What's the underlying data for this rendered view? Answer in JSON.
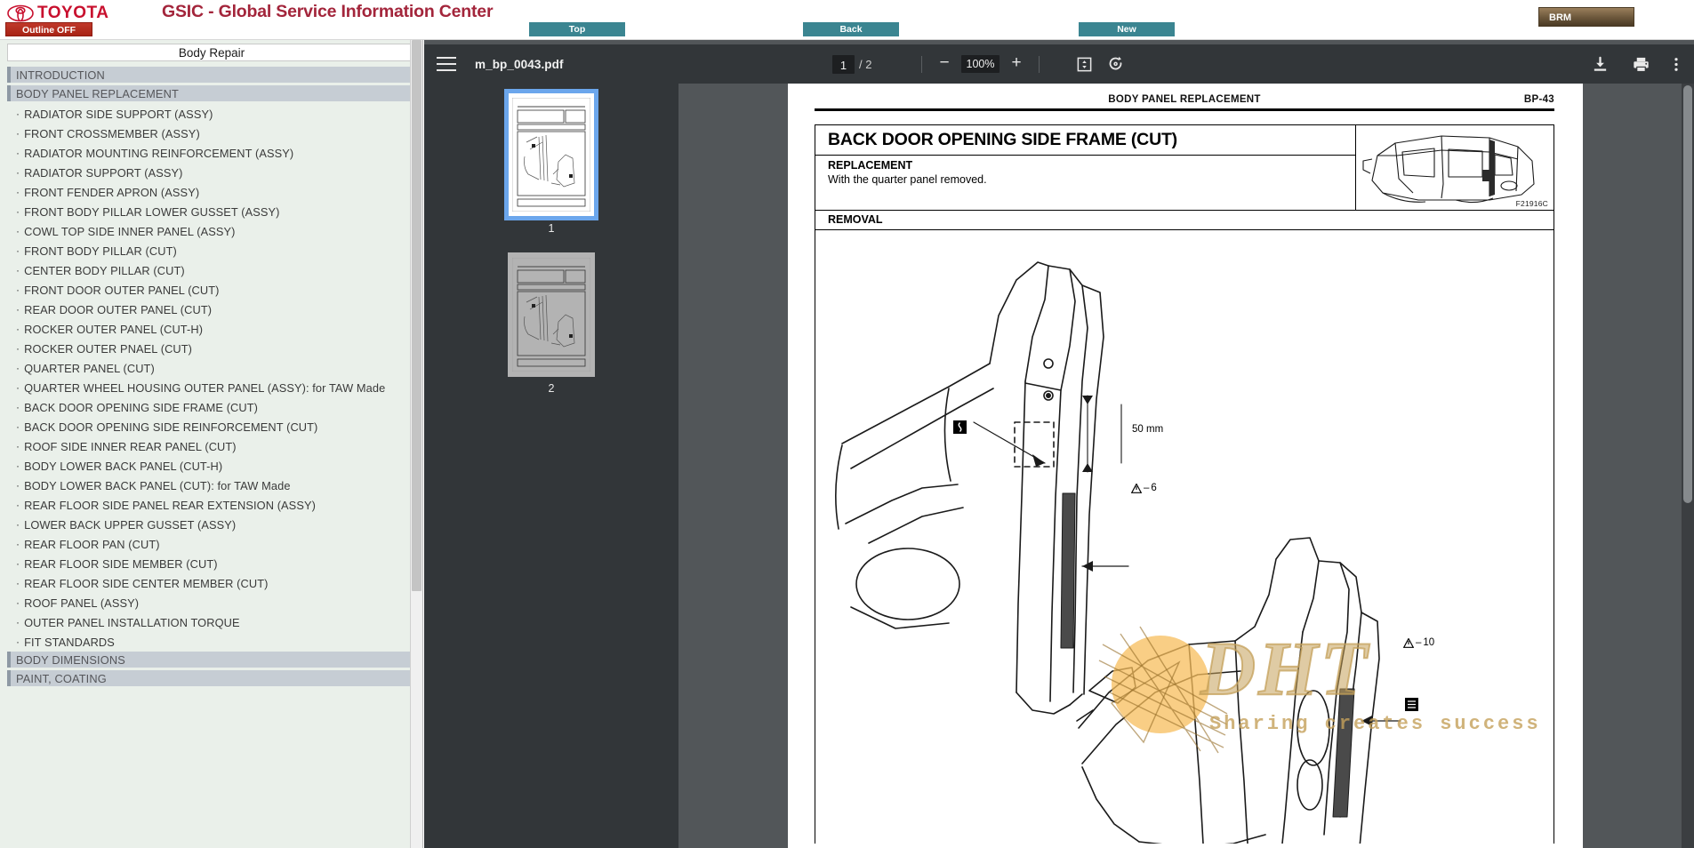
{
  "topbar": {
    "brand": "TOYOTA",
    "title": "GSIC - Global Service Information Center",
    "outline_button": "Outline OFF",
    "nav_buttons": [
      {
        "label": "Top",
        "name": "top-button"
      },
      {
        "label": "Back",
        "name": "back-button"
      },
      {
        "label": "New",
        "name": "new-button"
      }
    ],
    "account_button": "BRM"
  },
  "sidebar": {
    "header": "Body Repair",
    "groups": [
      {
        "label": "INTRODUCTION",
        "items": []
      },
      {
        "label": "BODY PANEL REPLACEMENT",
        "items": [
          "RADIATOR SIDE SUPPORT (ASSY)",
          "FRONT CROSSMEMBER (ASSY)",
          "RADIATOR MOUNTING REINFORCEMENT (ASSY)",
          "RADIATOR SUPPORT (ASSY)",
          "FRONT FENDER APRON (ASSY)",
          "FRONT BODY PILLAR LOWER GUSSET (ASSY)",
          "COWL TOP SIDE INNER PANEL (ASSY)",
          "FRONT BODY PILLAR (CUT)",
          "CENTER BODY PILLAR (CUT)",
          "FRONT DOOR OUTER PANEL (CUT)",
          "REAR DOOR OUTER PANEL (CUT)",
          "ROCKER OUTER PANEL (CUT-H)",
          "ROCKER OUTER PNAEL (CUT)",
          "QUARTER PANEL (CUT)",
          "QUARTER WHEEL HOUSING OUTER PANEL (ASSY): for TAW Made",
          "BACK DOOR OPENING SIDE FRAME (CUT)",
          "BACK DOOR OPENING SIDE REINFORCEMENT (CUT)",
          "ROOF SIDE INNER REAR PANEL (CUT)",
          "BODY LOWER BACK PANEL (CUT-H)",
          "BODY LOWER BACK PANEL (CUT): for TAW Made",
          "REAR FLOOR SIDE PANEL REAR EXTENSION (ASSY)",
          "LOWER BACK UPPER GUSSET (ASSY)",
          "REAR FLOOR PAN (CUT)",
          "REAR FLOOR SIDE MEMBER (CUT)",
          "REAR FLOOR SIDE CENTER MEMBER (CUT)",
          "ROOF PANEL (ASSY)",
          "OUTER PANEL INSTALLATION TORQUE",
          "FIT STANDARDS"
        ]
      },
      {
        "label": "BODY DIMENSIONS",
        "items": []
      },
      {
        "label": "PAINT, COATING",
        "items": []
      }
    ]
  },
  "pdf_toolbar": {
    "filename": "m_bp_0043.pdf",
    "menu_icon": "hamburger-icon",
    "page_current": "1",
    "page_separator": "/",
    "page_total": "2",
    "zoom_out_label": "−",
    "zoom_level": "100%",
    "zoom_in_label": "+",
    "fit_icon": "fit-page-icon",
    "rotate_icon": "rotate-icon",
    "download_icon": "download-icon",
    "print_icon": "print-icon",
    "more_icon": "more-options-icon"
  },
  "thumbnails": [
    {
      "label": "1",
      "selected": true
    },
    {
      "label": "2",
      "selected": false
    }
  ],
  "document": {
    "header_title": "BODY PANEL REPLACEMENT",
    "header_page": "BP-43",
    "section_title": "BACK DOOR OPENING SIDE FRAME (CUT)",
    "replacement_label": "REPLACEMENT",
    "replacement_note": "With the quarter panel removed.",
    "figure_ref": "F21916C",
    "removal_label": "REMOVAL",
    "annotations": {
      "dimension_50mm": "50 mm",
      "callout_6": "6",
      "callout_10": "10"
    }
  },
  "watermark": {
    "logo_text": "DHT",
    "tagline": "Sharing creates success"
  },
  "colors": {
    "toyota_red": "#c8102e",
    "title_red": "#a3253b",
    "nav_teal": "#3b8591",
    "brm_brown": "#6f5a3d",
    "sidebar_bg": "#eaf0ea",
    "group_bg": "#c6cdd4",
    "viewer_bg": "#525659",
    "toolbar_bg": "#323639",
    "thumb_select": "#6ba6ec"
  }
}
